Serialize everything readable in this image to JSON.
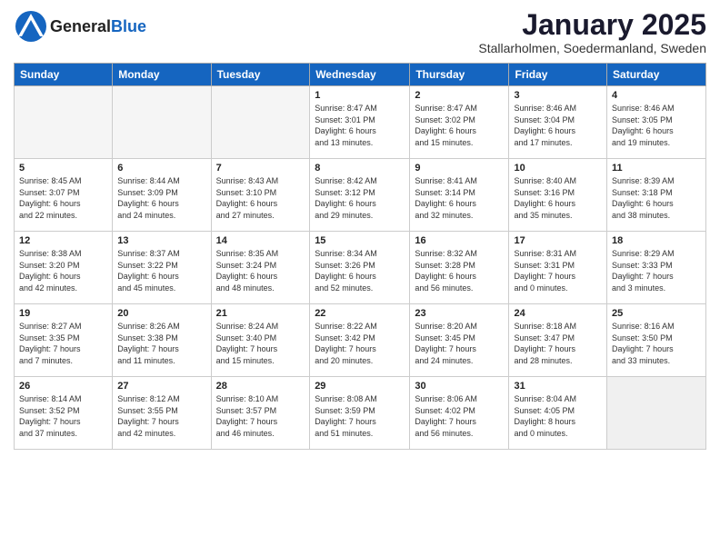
{
  "header": {
    "logo_general": "General",
    "logo_blue": "Blue",
    "month_title": "January 2025",
    "location": "Stallarholmen, Soedermanland, Sweden"
  },
  "weekdays": [
    "Sunday",
    "Monday",
    "Tuesday",
    "Wednesday",
    "Thursday",
    "Friday",
    "Saturday"
  ],
  "weeks": [
    [
      {
        "day": "",
        "info": ""
      },
      {
        "day": "",
        "info": ""
      },
      {
        "day": "",
        "info": ""
      },
      {
        "day": "1",
        "info": "Sunrise: 8:47 AM\nSunset: 3:01 PM\nDaylight: 6 hours\nand 13 minutes."
      },
      {
        "day": "2",
        "info": "Sunrise: 8:47 AM\nSunset: 3:02 PM\nDaylight: 6 hours\nand 15 minutes."
      },
      {
        "day": "3",
        "info": "Sunrise: 8:46 AM\nSunset: 3:04 PM\nDaylight: 6 hours\nand 17 minutes."
      },
      {
        "day": "4",
        "info": "Sunrise: 8:46 AM\nSunset: 3:05 PM\nDaylight: 6 hours\nand 19 minutes."
      }
    ],
    [
      {
        "day": "5",
        "info": "Sunrise: 8:45 AM\nSunset: 3:07 PM\nDaylight: 6 hours\nand 22 minutes."
      },
      {
        "day": "6",
        "info": "Sunrise: 8:44 AM\nSunset: 3:09 PM\nDaylight: 6 hours\nand 24 minutes."
      },
      {
        "day": "7",
        "info": "Sunrise: 8:43 AM\nSunset: 3:10 PM\nDaylight: 6 hours\nand 27 minutes."
      },
      {
        "day": "8",
        "info": "Sunrise: 8:42 AM\nSunset: 3:12 PM\nDaylight: 6 hours\nand 29 minutes."
      },
      {
        "day": "9",
        "info": "Sunrise: 8:41 AM\nSunset: 3:14 PM\nDaylight: 6 hours\nand 32 minutes."
      },
      {
        "day": "10",
        "info": "Sunrise: 8:40 AM\nSunset: 3:16 PM\nDaylight: 6 hours\nand 35 minutes."
      },
      {
        "day": "11",
        "info": "Sunrise: 8:39 AM\nSunset: 3:18 PM\nDaylight: 6 hours\nand 38 minutes."
      }
    ],
    [
      {
        "day": "12",
        "info": "Sunrise: 8:38 AM\nSunset: 3:20 PM\nDaylight: 6 hours\nand 42 minutes."
      },
      {
        "day": "13",
        "info": "Sunrise: 8:37 AM\nSunset: 3:22 PM\nDaylight: 6 hours\nand 45 minutes."
      },
      {
        "day": "14",
        "info": "Sunrise: 8:35 AM\nSunset: 3:24 PM\nDaylight: 6 hours\nand 48 minutes."
      },
      {
        "day": "15",
        "info": "Sunrise: 8:34 AM\nSunset: 3:26 PM\nDaylight: 6 hours\nand 52 minutes."
      },
      {
        "day": "16",
        "info": "Sunrise: 8:32 AM\nSunset: 3:28 PM\nDaylight: 6 hours\nand 56 minutes."
      },
      {
        "day": "17",
        "info": "Sunrise: 8:31 AM\nSunset: 3:31 PM\nDaylight: 7 hours\nand 0 minutes."
      },
      {
        "day": "18",
        "info": "Sunrise: 8:29 AM\nSunset: 3:33 PM\nDaylight: 7 hours\nand 3 minutes."
      }
    ],
    [
      {
        "day": "19",
        "info": "Sunrise: 8:27 AM\nSunset: 3:35 PM\nDaylight: 7 hours\nand 7 minutes."
      },
      {
        "day": "20",
        "info": "Sunrise: 8:26 AM\nSunset: 3:38 PM\nDaylight: 7 hours\nand 11 minutes."
      },
      {
        "day": "21",
        "info": "Sunrise: 8:24 AM\nSunset: 3:40 PM\nDaylight: 7 hours\nand 15 minutes."
      },
      {
        "day": "22",
        "info": "Sunrise: 8:22 AM\nSunset: 3:42 PM\nDaylight: 7 hours\nand 20 minutes."
      },
      {
        "day": "23",
        "info": "Sunrise: 8:20 AM\nSunset: 3:45 PM\nDaylight: 7 hours\nand 24 minutes."
      },
      {
        "day": "24",
        "info": "Sunrise: 8:18 AM\nSunset: 3:47 PM\nDaylight: 7 hours\nand 28 minutes."
      },
      {
        "day": "25",
        "info": "Sunrise: 8:16 AM\nSunset: 3:50 PM\nDaylight: 7 hours\nand 33 minutes."
      }
    ],
    [
      {
        "day": "26",
        "info": "Sunrise: 8:14 AM\nSunset: 3:52 PM\nDaylight: 7 hours\nand 37 minutes."
      },
      {
        "day": "27",
        "info": "Sunrise: 8:12 AM\nSunset: 3:55 PM\nDaylight: 7 hours\nand 42 minutes."
      },
      {
        "day": "28",
        "info": "Sunrise: 8:10 AM\nSunset: 3:57 PM\nDaylight: 7 hours\nand 46 minutes."
      },
      {
        "day": "29",
        "info": "Sunrise: 8:08 AM\nSunset: 3:59 PM\nDaylight: 7 hours\nand 51 minutes."
      },
      {
        "day": "30",
        "info": "Sunrise: 8:06 AM\nSunset: 4:02 PM\nDaylight: 7 hours\nand 56 minutes."
      },
      {
        "day": "31",
        "info": "Sunrise: 8:04 AM\nSunset: 4:05 PM\nDaylight: 8 hours\nand 0 minutes."
      },
      {
        "day": "",
        "info": ""
      }
    ]
  ]
}
